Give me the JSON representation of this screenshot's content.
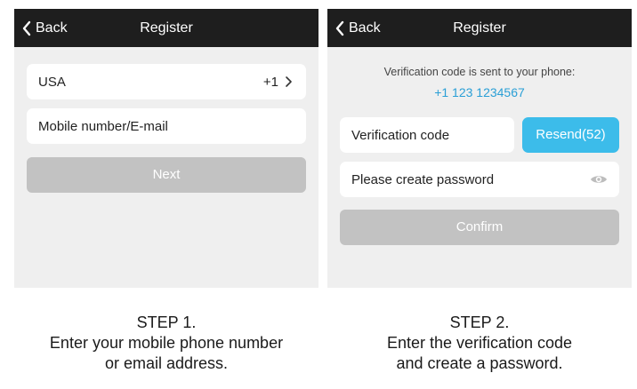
{
  "screen1": {
    "back_label": "Back",
    "title": "Register",
    "country": "USA",
    "country_code": "+1",
    "contact_placeholder": "Mobile number/E-mail",
    "next_label": "Next"
  },
  "screen2": {
    "back_label": "Back",
    "title": "Register",
    "info_text": "Verification code is sent to your phone:",
    "phone": "+1 123 1234567",
    "code_placeholder": "Verification code",
    "resend_label": "Resend(52)",
    "password_placeholder": "Please create password",
    "confirm_label": "Confirm"
  },
  "captions": {
    "step1_title": "STEP 1.",
    "step1_line1": "Enter your mobile phone number",
    "step1_line2": "or email address.",
    "step2_title": "STEP 2.",
    "step2_line1": "Enter the verification code",
    "step2_line2": "and create a password."
  },
  "colors": {
    "navbar": "#1e1e1e",
    "accent": "#3cbcea",
    "phone_link": "#2a9fd6",
    "disabled_button": "#c2c2c2",
    "screen_bg": "#efefef"
  },
  "icons": [
    "chevron-left-icon",
    "chevron-right-icon",
    "eye-icon"
  ]
}
